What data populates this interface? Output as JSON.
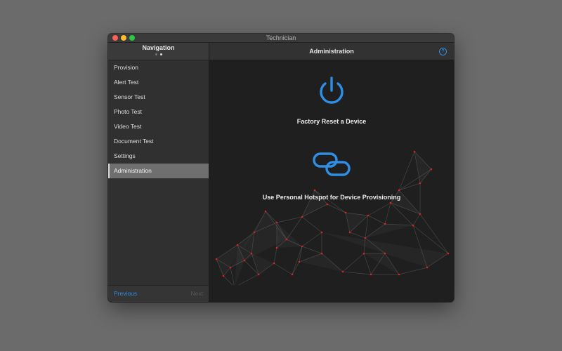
{
  "window": {
    "title": "Technician"
  },
  "sidebar": {
    "title": "Navigation",
    "items": [
      {
        "label": "Provision"
      },
      {
        "label": "Alert Test"
      },
      {
        "label": "Sensor Test"
      },
      {
        "label": "Photo Test"
      },
      {
        "label": "Video Test"
      },
      {
        "label": "Document Test"
      },
      {
        "label": "Settings"
      },
      {
        "label": "Administration",
        "selected": true
      }
    ],
    "footer": {
      "previous": "Previous",
      "next": "Next"
    }
  },
  "main": {
    "title": "Administration",
    "help_icon": "?",
    "actions": [
      {
        "label": "Factory Reset a Device",
        "icon": "power-icon"
      },
      {
        "label": "Use Personal Hotspot for Device Provisioning",
        "icon": "link-icon"
      }
    ]
  },
  "colors": {
    "accent": "#2f8ee6",
    "mesh_node": "#e02020"
  }
}
